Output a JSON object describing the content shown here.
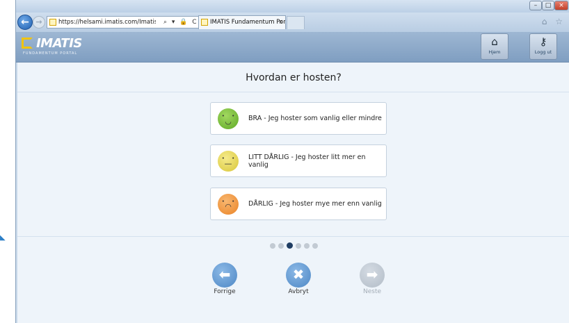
{
  "browser": {
    "url_host": "https://helsami.imatis.com",
    "url_path": "/Imatis/Portal/I",
    "address_tools": "⌕ ▾ 🔒 C ✕",
    "tab_title": "IMATIS Fundamentum Portal",
    "tab_close": "×",
    "window_min": "–",
    "window_max": "□",
    "window_close": "×",
    "back_glyph": "←",
    "forward_glyph": "→",
    "home_star": "⌂ ☆"
  },
  "app": {
    "logo_name": "IMATIS",
    "logo_sub": "FUNDAMENTUM PORTAL",
    "home_label": "Hjem",
    "logout_label": "Logg ut",
    "home_icon": "home-icon",
    "logout_icon": "key-icon"
  },
  "survey": {
    "question": "Hvordan er hosten?",
    "options": [
      {
        "label": "BRA - Jeg hoster som vanlig eller mindre",
        "face": "happy",
        "color": "#6cb52e",
        "eyes": "• •",
        "mouth": "◡"
      },
      {
        "label": "LITT DÅRLIG - Jeg hoster litt mer en vanlig",
        "face": "neutral",
        "color": "#e3d245",
        "eyes": "• •",
        "mouth": "—"
      },
      {
        "label": "DÅRLIG - Jeg hoster mye mer enn vanlig",
        "face": "sad",
        "color": "#f0902f",
        "eyes": "• •",
        "mouth": "◠"
      }
    ],
    "pagination": {
      "total": 6,
      "current": 3
    },
    "nav": {
      "prev_label": "Forrige",
      "cancel_label": "Avbryt",
      "next_label": "Neste",
      "prev_glyph": "⬅",
      "cancel_glyph": "✖",
      "next_glyph": "➡"
    }
  },
  "colors": {
    "accent": "#4d87c5",
    "header": "#8aa8c9",
    "active_dot": "#1f3d63"
  }
}
